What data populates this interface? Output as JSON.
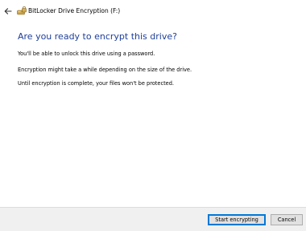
{
  "window": {
    "title": "BitLocker Drive Encryption (F:)",
    "icons": {
      "back": "back-arrow-icon",
      "app": "bitlocker-drive-icon"
    }
  },
  "content": {
    "heading": "Are you ready to encrypt this drive?",
    "paragraphs": [
      "You'll be able to unlock this drive using a password.",
      "Encryption might take a while depending on the size of the drive.",
      "Until encryption is complete, your files won't be protected."
    ]
  },
  "footer": {
    "start_label": "Start encrypting",
    "cancel_label": "Cancel"
  },
  "colors": {
    "heading": "#1e3f9a",
    "footer_bg": "#f0f0f0",
    "button_bg": "#e1e1e1",
    "accent_border": "#0078d7"
  }
}
